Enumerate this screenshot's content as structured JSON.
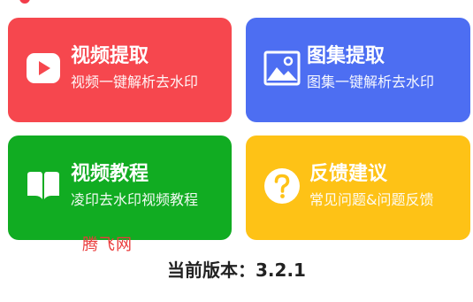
{
  "cards": [
    {
      "title": "视频提取",
      "subtitle": "视频一键解析去水印",
      "icon": "video-play-icon",
      "color": "#f6474e"
    },
    {
      "title": "图集提取",
      "subtitle": "图集一键解析去水印",
      "icon": "image-gallery-icon",
      "color": "#4d6ef2"
    },
    {
      "title": "视频教程",
      "subtitle": "凌印去水印视频教程",
      "icon": "open-book-icon",
      "color": "#11ac22"
    },
    {
      "title": "反馈建议",
      "subtitle": "常见问题&问题反馈",
      "icon": "question-circle-icon",
      "color": "#fec216"
    }
  ],
  "watermark": "腾飞网",
  "version_text": "当前版本：3.2.1"
}
